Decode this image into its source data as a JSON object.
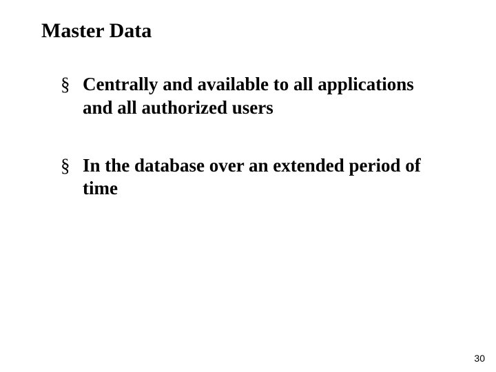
{
  "slide": {
    "title": "Master Data",
    "bullets": [
      "Centrally and available to all applications and all authorized users",
      "In the database over an extended period of time"
    ],
    "page_number": "30"
  }
}
